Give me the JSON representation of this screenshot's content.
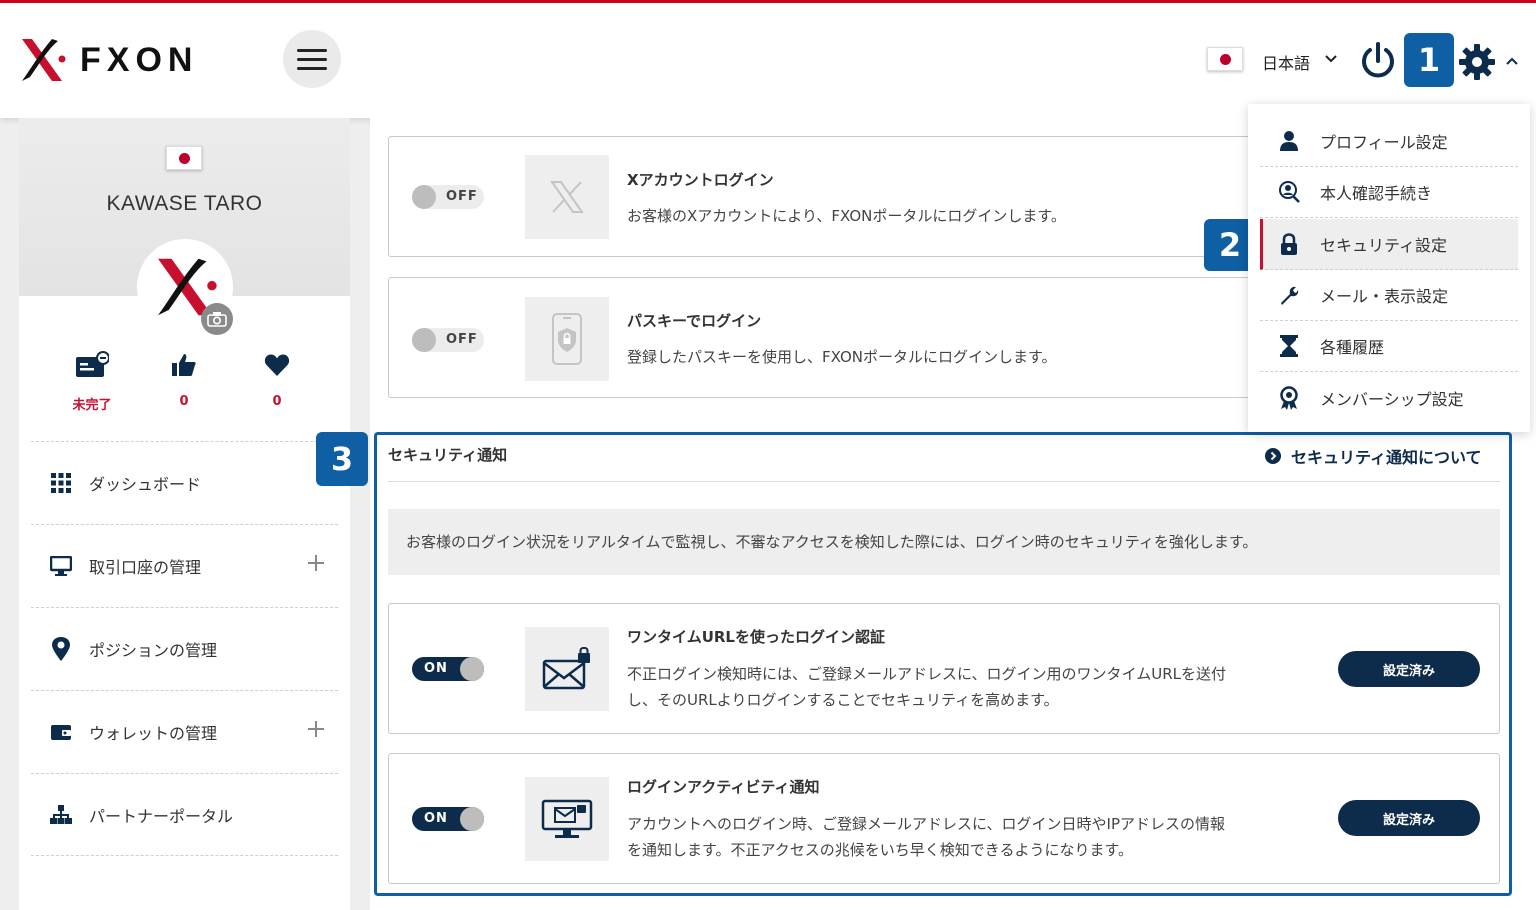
{
  "header": {
    "logo_text": "FXON",
    "language": "日本語",
    "steps": [
      "1",
      "2",
      "3"
    ]
  },
  "sidebar": {
    "user_name": "KAWASE TARO",
    "stats": [
      {
        "label": "未完了",
        "icon": "id-card-icon"
      },
      {
        "label": "0",
        "icon": "thumbs-up-icon"
      },
      {
        "label": "0",
        "icon": "heart-icon"
      }
    ],
    "nav": [
      {
        "label": "ダッシュボード",
        "icon": "grid-icon",
        "expandable": false
      },
      {
        "label": "取引口座の管理",
        "icon": "monitor-icon",
        "expandable": true
      },
      {
        "label": "ポジションの管理",
        "icon": "map-pin-icon",
        "expandable": false
      },
      {
        "label": "ウォレットの管理",
        "icon": "wallet-icon",
        "expandable": true
      },
      {
        "label": "パートナーポータル",
        "icon": "org-chart-icon",
        "expandable": false
      }
    ]
  },
  "main": {
    "login_cards": [
      {
        "toggle": "OFF",
        "title": "Xアカウントログイン",
        "desc": "お客様のXアカウントにより、FXONポータルにログインします。",
        "icon": "x-logo-icon"
      },
      {
        "toggle": "OFF",
        "title": "パスキーでログイン",
        "desc": "登録したパスキーを使用し、FXONポータルにログインします。",
        "icon": "passkey-phone-icon"
      }
    ],
    "security_section": {
      "title": "セキュリティ通知",
      "link": "セキュリティ通知について",
      "info": "お客様のログイン状況をリアルタイムで監視し、不審なアクセスを検知した際には、ログイン時のセキュリティを強化します。",
      "cards": [
        {
          "toggle": "ON",
          "title": "ワンタイムURLを使ったログイン認証",
          "desc_line1": "不正ログイン検知時には、ご登録メールアドレスに、ログイン用のワンタイムURLを送付",
          "desc_line2": "し、そのURLよりログインすることでセキュリティを高めます。",
          "status": "設定済み",
          "icon": "mail-lock-icon"
        },
        {
          "toggle": "ON",
          "title": "ログインアクティビティ通知",
          "desc_line1": "アカウントへのログイン時、ご登録メールアドレスに、ログイン日時やIPアドレスの情報",
          "desc_line2": "を通知します。不正アクセスの兆候をいち早く検知できるようになります。",
          "status": "設定済み",
          "icon": "monitor-mail-icon"
        }
      ]
    }
  },
  "settings_menu": {
    "items": [
      {
        "label": "プロフィール設定",
        "icon": "user-icon",
        "active": false
      },
      {
        "label": "本人確認手続き",
        "icon": "id-verify-icon",
        "active": false
      },
      {
        "label": "セキュリティ設定",
        "icon": "lock-icon",
        "active": true
      },
      {
        "label": "メール・表示設定",
        "icon": "wrench-icon",
        "active": false
      },
      {
        "label": "各種履歴",
        "icon": "hourglass-icon",
        "active": false
      },
      {
        "label": "メンバーシップ設定",
        "icon": "award-icon",
        "active": false
      }
    ]
  },
  "colors": {
    "brand_red": "#c8102e",
    "navy": "#0d2b4a",
    "step_blue": "#0e5fa3"
  }
}
